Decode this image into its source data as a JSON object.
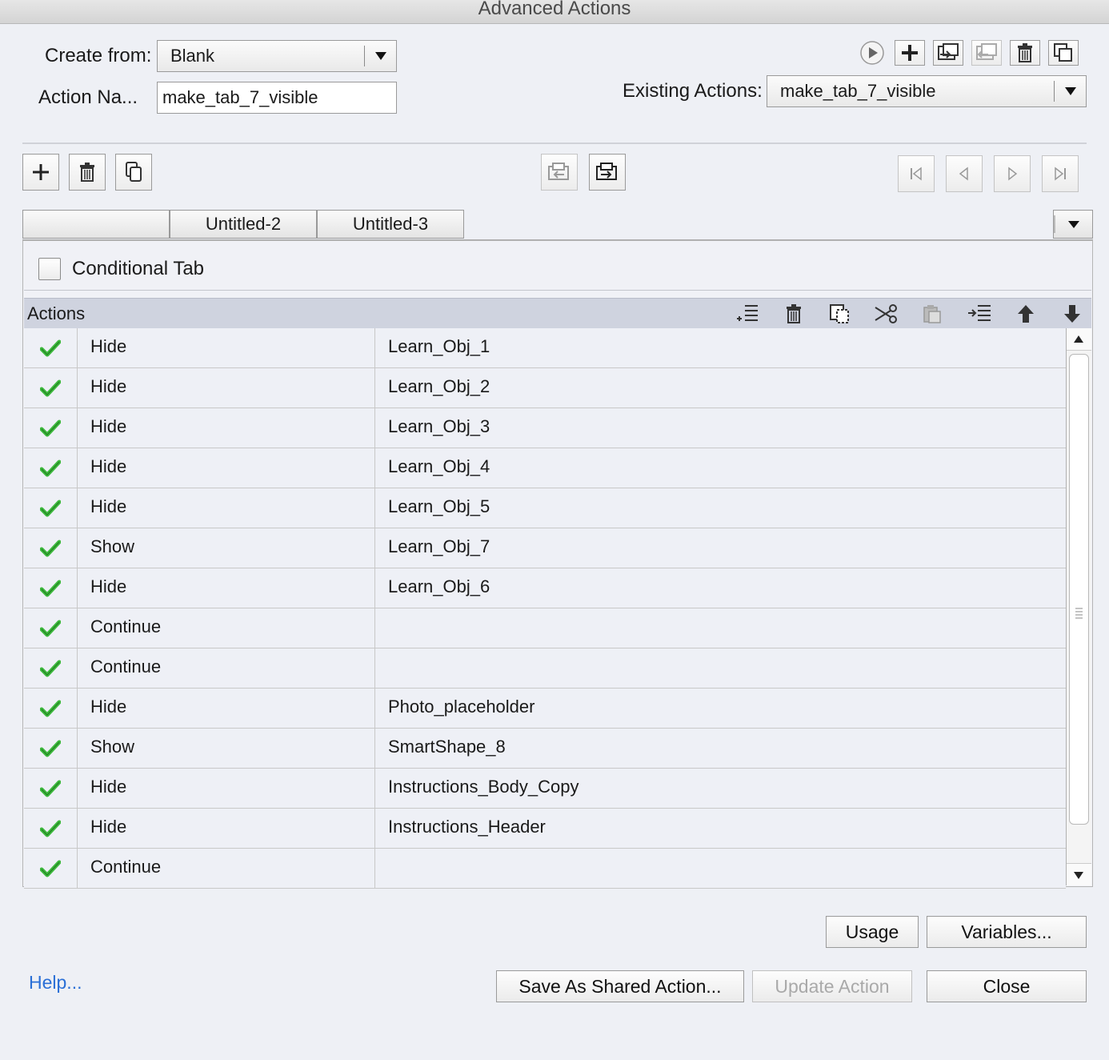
{
  "window": {
    "title": "Advanced Actions"
  },
  "form": {
    "create_from_label": "Create from:",
    "create_from_value": "Blank",
    "action_name_label": "Action Na...",
    "action_name_value": "make_tab_7_visible",
    "existing_actions_label": "Existing Actions:",
    "existing_actions_value": "make_tab_7_visible"
  },
  "tabs": [
    {
      "label": ""
    },
    {
      "label": "Untitled-2"
    },
    {
      "label": "Untitled-3"
    }
  ],
  "conditional_tab": {
    "label": "Conditional Tab",
    "checked": false
  },
  "actions_header": {
    "title": "Actions"
  },
  "actions": [
    {
      "verb": "Hide",
      "target": "Learn_Obj_1"
    },
    {
      "verb": "Hide",
      "target": "Learn_Obj_2"
    },
    {
      "verb": "Hide",
      "target": "Learn_Obj_3"
    },
    {
      "verb": "Hide",
      "target": "Learn_Obj_4"
    },
    {
      "verb": "Hide",
      "target": "Learn_Obj_5"
    },
    {
      "verb": "Show",
      "target": "Learn_Obj_7"
    },
    {
      "verb": "Hide",
      "target": "Learn_Obj_6"
    },
    {
      "verb": "Continue",
      "target": ""
    },
    {
      "verb": "Continue",
      "target": ""
    },
    {
      "verb": "Hide",
      "target": "Photo_placeholder"
    },
    {
      "verb": "Show",
      "target": "SmartShape_8"
    },
    {
      "verb": "Hide",
      "target": "Instructions_Body_Copy"
    },
    {
      "verb": "Hide",
      "target": "Instructions_Header"
    },
    {
      "verb": "Continue",
      "target": ""
    }
  ],
  "buttons": {
    "usage": "Usage",
    "variables": "Variables...",
    "help": "Help...",
    "save_shared": "Save As Shared Action...",
    "update": "Update Action",
    "close": "Close"
  },
  "colors": {
    "check": "#3cb83c",
    "link": "#2a6fd6"
  }
}
